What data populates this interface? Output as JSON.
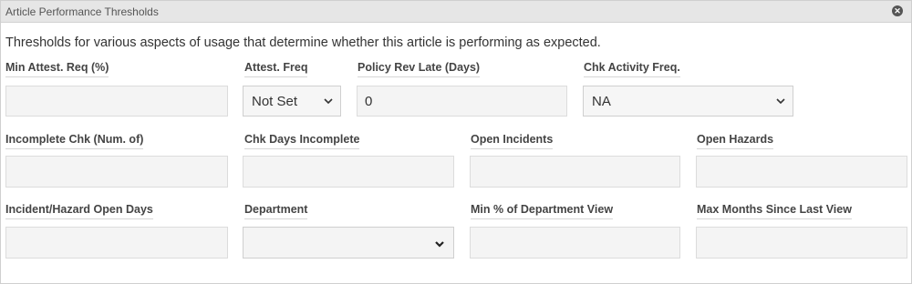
{
  "panel": {
    "title": "Article Performance Thresholds",
    "close_icon": "close-circle-icon"
  },
  "description": "Thresholds for various aspects of usage that determine whether this article is performing as expected.",
  "fields": {
    "min_attest_req": {
      "label": "Min Attest. Req (%)",
      "value": ""
    },
    "attest_freq": {
      "label": "Attest. Freq",
      "value": "Not Set"
    },
    "policy_rev_late": {
      "label": "Policy Rev Late (Days)",
      "value": "0"
    },
    "chk_activity_freq": {
      "label": "Chk Activity Freq.",
      "value": "NA"
    },
    "incomplete_chk": {
      "label": "Incomplete Chk (Num. of)",
      "value": ""
    },
    "chk_days_incomplete": {
      "label": "Chk Days Incomplete",
      "value": ""
    },
    "open_incidents": {
      "label": "Open Incidents",
      "value": ""
    },
    "open_hazards": {
      "label": "Open Hazards",
      "value": ""
    },
    "incident_hazard_open_days": {
      "label": "Incident/Hazard Open Days",
      "value": ""
    },
    "department": {
      "label": "Department",
      "value": ""
    },
    "min_pct_department_view": {
      "label": "Min % of Department View",
      "value": ""
    },
    "max_months_since_last_view": {
      "label": "Max Months Since Last View",
      "value": ""
    }
  },
  "icons": {
    "dropdown": "chevron-down-icon"
  }
}
